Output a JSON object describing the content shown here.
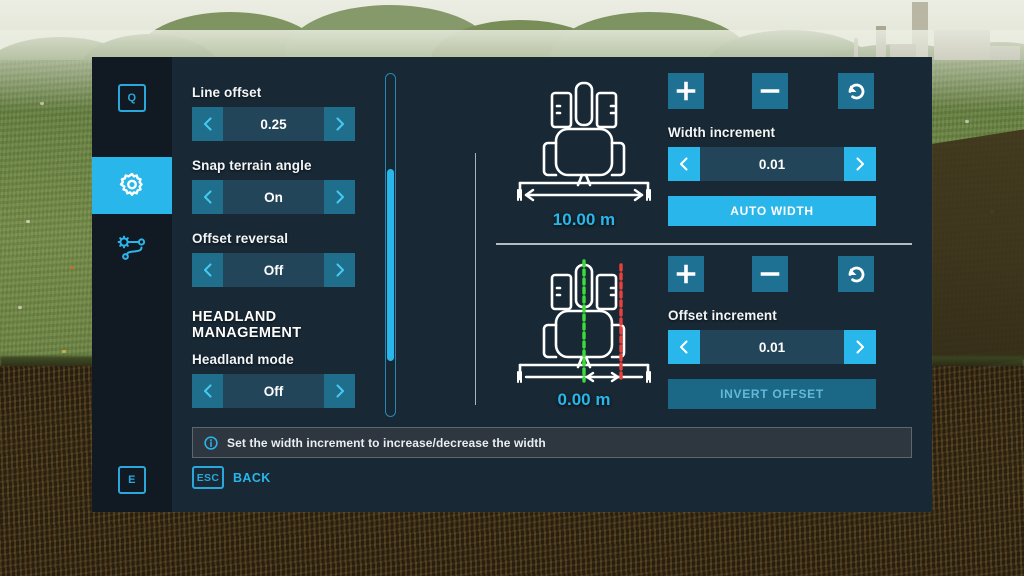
{
  "sidebar": {
    "key_top": "Q",
    "key_bottom": "E",
    "tabs": [
      {
        "name": "settings",
        "icon": "gear-icon",
        "active": true
      },
      {
        "name": "course",
        "icon": "gear-route-icon",
        "active": false
      }
    ]
  },
  "left_column": {
    "fields": [
      {
        "label": "Line offset",
        "value": "0.25"
      },
      {
        "label": "Snap terrain angle",
        "value": "On"
      },
      {
        "label": "Offset reversal",
        "value": "Off"
      }
    ],
    "section_title": "HEADLAND MANAGEMENT",
    "section_fields": [
      {
        "label": "Headland mode",
        "value": "Off"
      }
    ]
  },
  "diagrams": {
    "width": {
      "dimension": "10.00 m",
      "name": "working-width-diagram"
    },
    "offset": {
      "dimension": "0.00 m",
      "name": "offset-diagram"
    }
  },
  "right_column": {
    "width_group": {
      "plus_label": "+",
      "minus_label": "−",
      "reset_label": "reset",
      "field_label": "Width increment",
      "field_value": "0.01",
      "action_label": "AUTO WIDTH"
    },
    "offset_group": {
      "plus_label": "+",
      "minus_label": "−",
      "reset_label": "reset",
      "field_label": "Offset increment",
      "field_value": "0.01",
      "action_label": "INVERT OFFSET"
    }
  },
  "tooltip": {
    "icon": "info-icon",
    "text": "Set the width increment to increase/decrease the width"
  },
  "footer": {
    "esc_key": "ESC",
    "back_label": "BACK"
  },
  "colors": {
    "accent": "#29b6ea",
    "panel_bg": "#182834",
    "sidebar_bg": "#111a21",
    "stepper_bg": "#244a5f",
    "arrow_bg": "#1f6e8c",
    "green_line": "#3ddc3d",
    "red_line": "#e8413c"
  }
}
